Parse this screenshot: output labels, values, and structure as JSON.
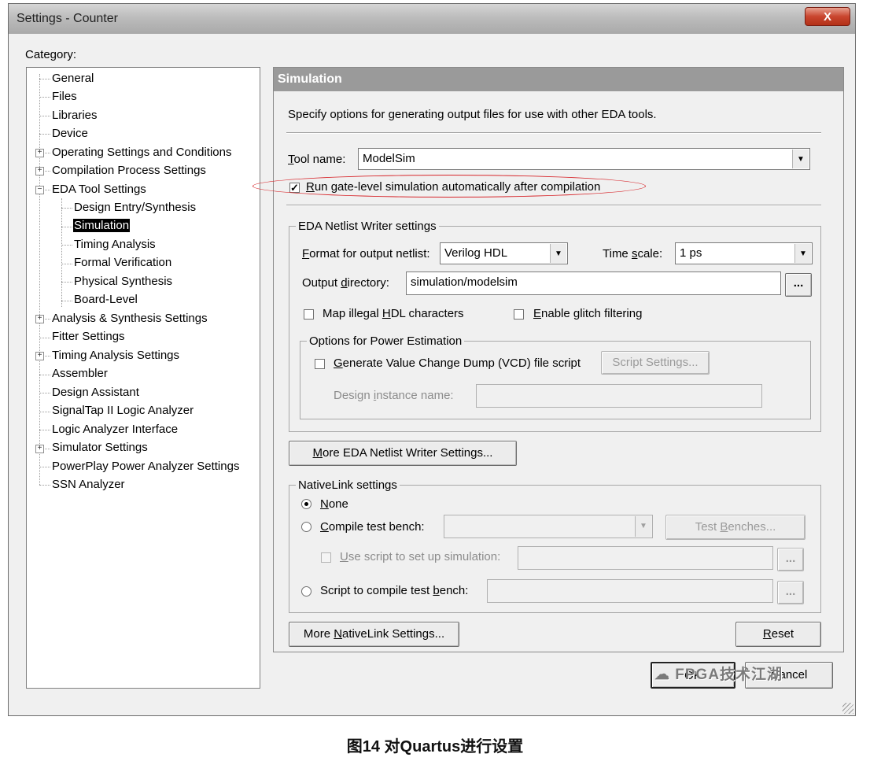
{
  "window": {
    "title": "Settings - Counter",
    "close_label": "X"
  },
  "category": {
    "label": "Category:",
    "items": [
      "General",
      "Files",
      "Libraries",
      "Device",
      "Operating Settings and Conditions",
      "Compilation Process Settings",
      "EDA Tool Settings",
      "Design Entry/Synthesis",
      "Simulation",
      "Timing Analysis",
      "Formal Verification",
      "Physical Synthesis",
      "Board-Level",
      "Analysis & Synthesis Settings",
      "Fitter Settings",
      "Timing Analysis Settings",
      "Assembler",
      "Design Assistant",
      "SignalTap II Logic Analyzer",
      "Logic Analyzer Interface",
      "Simulator Settings",
      "PowerPlay Power Analyzer Settings",
      "SSN Analyzer"
    ],
    "selected": "Simulation"
  },
  "simulation": {
    "header": "Simulation",
    "description": "Specify options for generating output files for use with other EDA tools.",
    "tool_name_label_u": "T",
    "tool_name_label_rest": "ool name:",
    "tool_name_value": "ModelSim",
    "run_gate_level_u": "R",
    "run_gate_level_rest": "un gate-level simulation automatically after compilation",
    "run_gate_level_checked": true
  },
  "netlist": {
    "group_label": "EDA Netlist Writer settings",
    "format_label_u": "F",
    "format_label_rest": "ormat for output netlist:",
    "format_value": "Verilog HDL",
    "timescale_label_a": "Time ",
    "timescale_label_u": "s",
    "timescale_label_b": "cale:",
    "timescale_value": "1 ps",
    "outdir_label_a": "Output ",
    "outdir_label_u": "d",
    "outdir_label_b": "irectory:",
    "outdir_value": "simulation/modelsim",
    "browse_label": "...",
    "map_illegal_a": "Map illegal ",
    "map_illegal_u": "H",
    "map_illegal_b": "DL characters",
    "enable_glitch_u": "E",
    "enable_glitch_rest": "nable glitch filtering"
  },
  "power": {
    "group_label": "Options for Power Estimation",
    "vcd_u": "G",
    "vcd_rest": "enerate Value Change Dump (VCD) file script",
    "script_settings_label": "Script Settings...",
    "design_instance_a": "Design ",
    "design_instance_u": "i",
    "design_instance_b": "nstance name:"
  },
  "more_eda_label_u": "M",
  "more_eda_label_rest": "ore EDA Netlist Writer Settings...",
  "nativelink": {
    "group_label": "NativeLink settings",
    "none_a": "N",
    "none_b": "one",
    "compile_tb_u": "C",
    "compile_tb_rest": "ompile test bench:",
    "test_benches_a": "Test ",
    "test_benches_u": "B",
    "test_benches_b": "enches...",
    "use_script_u": "U",
    "use_script_rest": "se script to set up simulation:",
    "script_compile_a": "Script to compile test ",
    "script_compile_u": "b",
    "script_compile_b": "ench:",
    "browse_label": "...",
    "selected_option": "None"
  },
  "more_nativelink_a": "More ",
  "more_nativelink_u": "N",
  "more_nativelink_b": "ativeLink Settings...",
  "reset_u": "R",
  "reset_rest": "eset",
  "footer": {
    "ok_label": "OK",
    "cancel_label": "Cancel"
  },
  "watermark": "FPGA技术江湖",
  "caption": "图14 对Quartus进行设置"
}
